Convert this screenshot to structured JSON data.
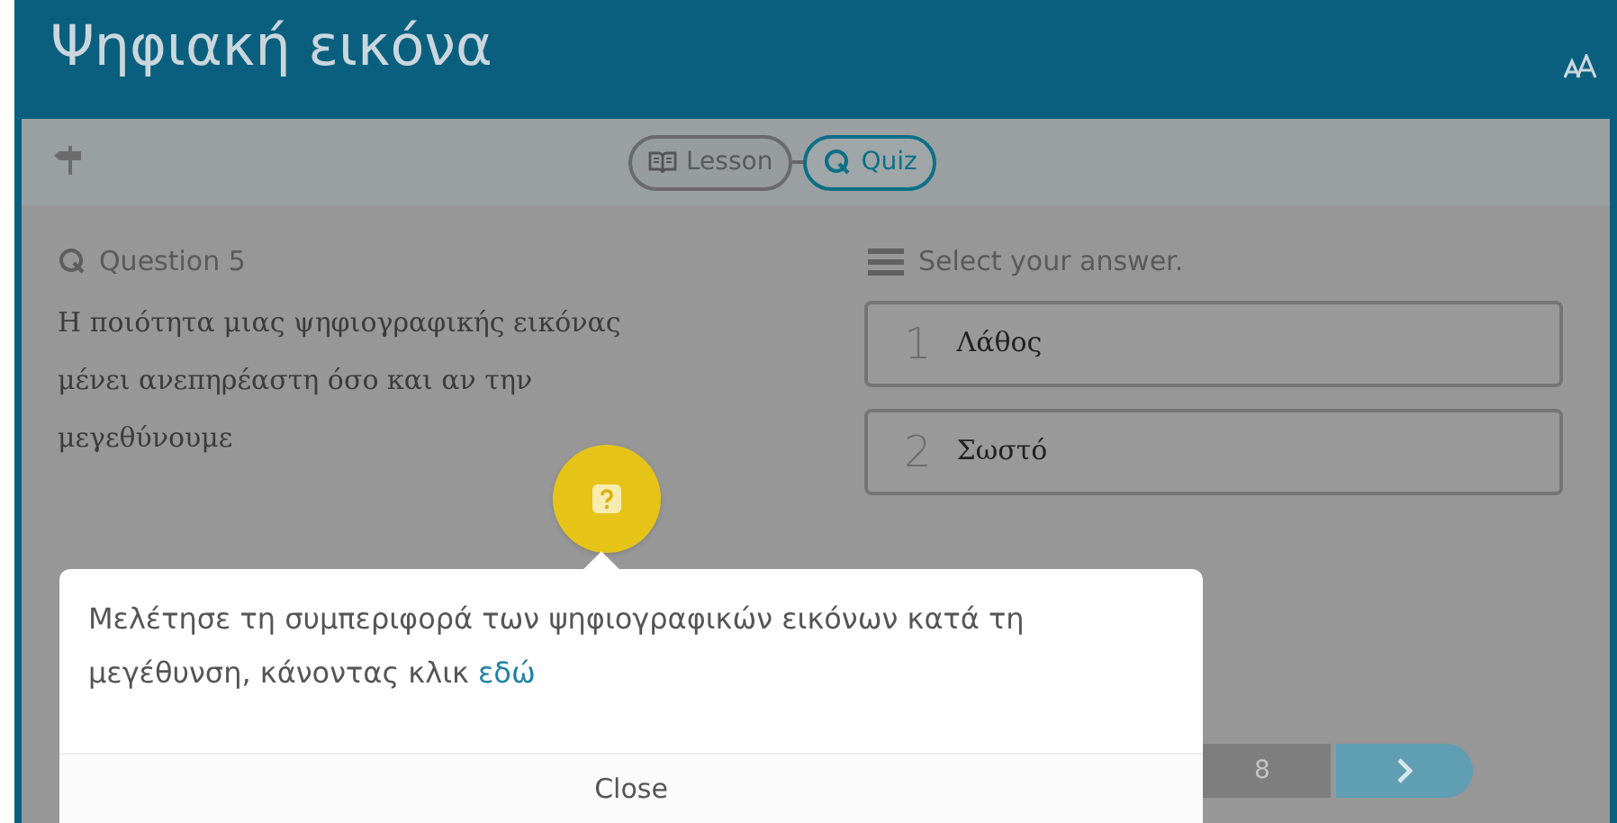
{
  "window": {
    "title": "Ψηφιακή εικόνα"
  },
  "tabs": [
    {
      "label": "Lesson",
      "kind": "lesson",
      "selected": false
    },
    {
      "label": "Quiz",
      "kind": "quiz",
      "selected": true
    }
  ],
  "question": {
    "label": "Question 5",
    "text": "Η ποιότητα μιας ψηφιογραφικής εικόνας μένει ανεπηρέαστη όσο και αν την μεγεθύνουμε"
  },
  "answers": {
    "prompt": "Select your answer.",
    "options": [
      {
        "number": "1",
        "text": "Λάθος"
      },
      {
        "number": "2",
        "text": "Σωστό"
      }
    ]
  },
  "pager": {
    "pages": [
      "8"
    ]
  },
  "popup": {
    "text": "Μελέτησε τη συμπεριφορά των ψηφιογραφικών εικόνων κατά τη μεγέθυνση, κάνοντας κλικ",
    "link": "εδώ",
    "close": "Close"
  }
}
